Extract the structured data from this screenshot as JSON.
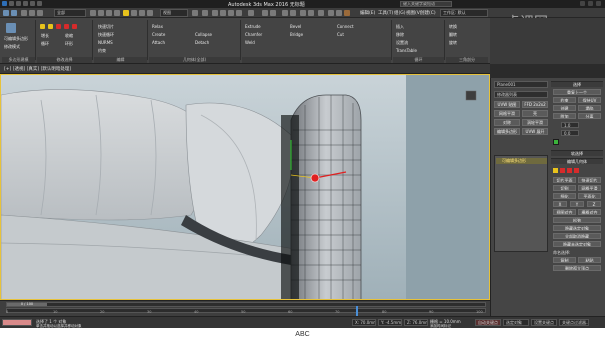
{
  "window": {
    "title": "Autodesk 3ds Max 2016   无标题",
    "search_placeholder": "键入关键字或短语"
  },
  "menu": {
    "items": [
      "编辑(E)",
      "工具(T)",
      "组(G)",
      "视图(V)",
      "创建(C)",
      "修改器(M)",
      "动画(A)",
      "图形编辑器(D)",
      "渲染(R)",
      "Civil View",
      "自定义(U)",
      "脚本(X)",
      "帮助(H)"
    ],
    "selection_filter": "全部",
    "view_dropdown": "视图",
    "workspace_dropdown": "工作区: 默认"
  },
  "ribbon": {
    "groups": [
      {
        "label": "多边形建模",
        "items": [
          "可编辑多边形",
          "修改模式"
        ]
      },
      {
        "label": "修改选择",
        "items": [
          "增长",
          "收缩",
          "循环",
          "环形"
        ]
      },
      {
        "label": "编辑",
        "items": [
          "快速切片",
          "快速循环",
          "NURMS",
          "约束"
        ]
      },
      {
        "label": "几何体(全部)",
        "items": [
          "Relax",
          "Create",
          "Attach",
          "Collapse",
          "Detach"
        ]
      },
      {
        "label": "",
        "items": [
          "Extrude",
          "Chamfer",
          "Weld",
          "Bevel",
          "Bridge",
          "Connect",
          "Cut"
        ]
      },
      {
        "label": "循环",
        "items": [
          "插入",
          "移除",
          "设置流",
          "TransTable"
        ]
      },
      {
        "label": "三角剖分",
        "items": [
          "转换",
          "翻转",
          "旋转"
        ]
      }
    ]
  },
  "viewport": {
    "label": "[+] [透视] [真实] [默认明暗处理]",
    "gizmo_color": "#e02020"
  },
  "command_panel": {
    "object_name": "Plane001",
    "modifier_list": "修改器列表",
    "quick_buttons": [
      "UVW 贴图",
      "FFD 2x2x2",
      "网格平滑",
      "壳",
      "对称",
      "涡轮平滑",
      "编辑多边形",
      "UVW 展开"
    ],
    "stack_item": "可编辑多边形",
    "right_sections": {
      "selection_title": "选择",
      "soft_selection_title": "软选择",
      "edit_geometry_title": "编辑几何体",
      "buttons": [
        "重复上一个",
        "约束",
        "保持UV",
        "创建",
        "塌陷",
        "附加",
        "分离",
        "切片平面",
        "快速切片",
        "切割",
        "网格平滑",
        "细化",
        "平面化",
        "X",
        "Y",
        "Z",
        "视图对齐",
        "栅格对齐",
        "松弛",
        "隐藏选定对象",
        "全部取消隐藏",
        "隐藏未选定对象",
        "命名选择:",
        "复制",
        "粘贴",
        "删除孤立顶点"
      ],
      "values": [
        "1.0",
        "0.0",
        "1"
      ]
    },
    "accent_green": "#3bb33b",
    "accent_red": "#d62b2b",
    "accent_yellow": "#e8c31c"
  },
  "timeline": {
    "frame": "0 / 100",
    "ticks": [
      "0",
      "10",
      "20",
      "30",
      "40",
      "50",
      "60",
      "70",
      "80",
      "90",
      "100"
    ]
  },
  "status": {
    "selection": "选择了 1 个 对象",
    "prompt": "单击并拖动以选择并移动对象",
    "x": "X: 70.0mm",
    "y": "Y: -4.5mm",
    "z": "Z: 76.0mm",
    "grid": "栅格 = 10.0mm",
    "add_time_tag": "添加时间标记",
    "auto_key": "自动关键点",
    "set_key": "设置关键点",
    "selected": "选定对象",
    "key_filters": "关键点过滤器..."
  },
  "watermark": "虎课网",
  "caption": "ABC"
}
